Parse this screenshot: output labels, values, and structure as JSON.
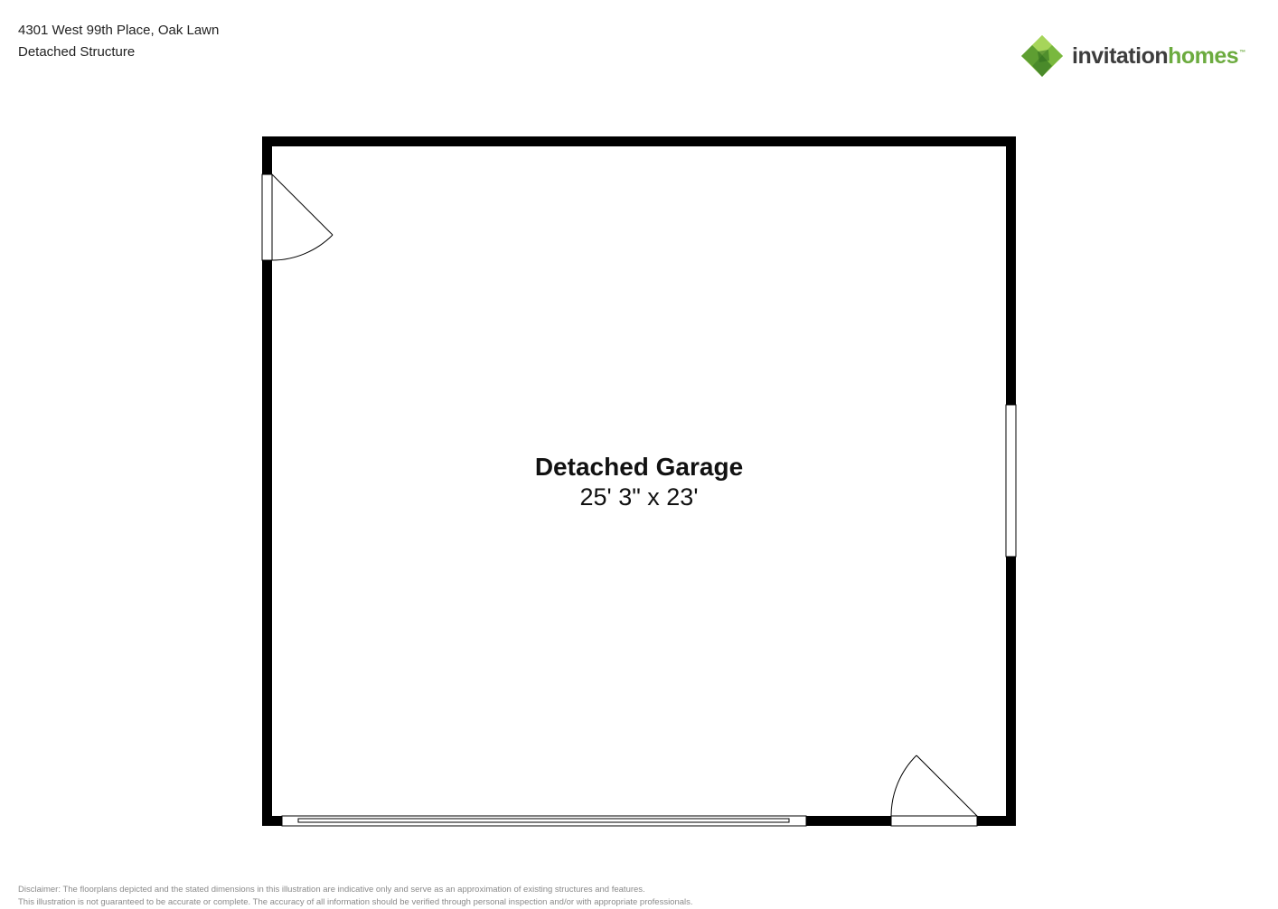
{
  "header": {
    "address": "4301 West 99th Place, Oak Lawn",
    "structure": "Detached Structure"
  },
  "logo": {
    "word1": "invitation",
    "word2": "homes",
    "mark": "™",
    "brand_green": "#6cab3f",
    "brand_gray": "#3d3d3d"
  },
  "room": {
    "name": "Detached Garage",
    "dimensions": "25' 3\" x 23'"
  },
  "disclaimer": {
    "line1": "Disclaimer: The floorplans depicted and the stated dimensions in this illustration are indicative only and serve as an approximation of existing structures and features.",
    "line2": "This illustration is not guaranteed to be accurate or complete. The accuracy of all information should be verified through personal inspection and/or with appropriate professionals."
  }
}
